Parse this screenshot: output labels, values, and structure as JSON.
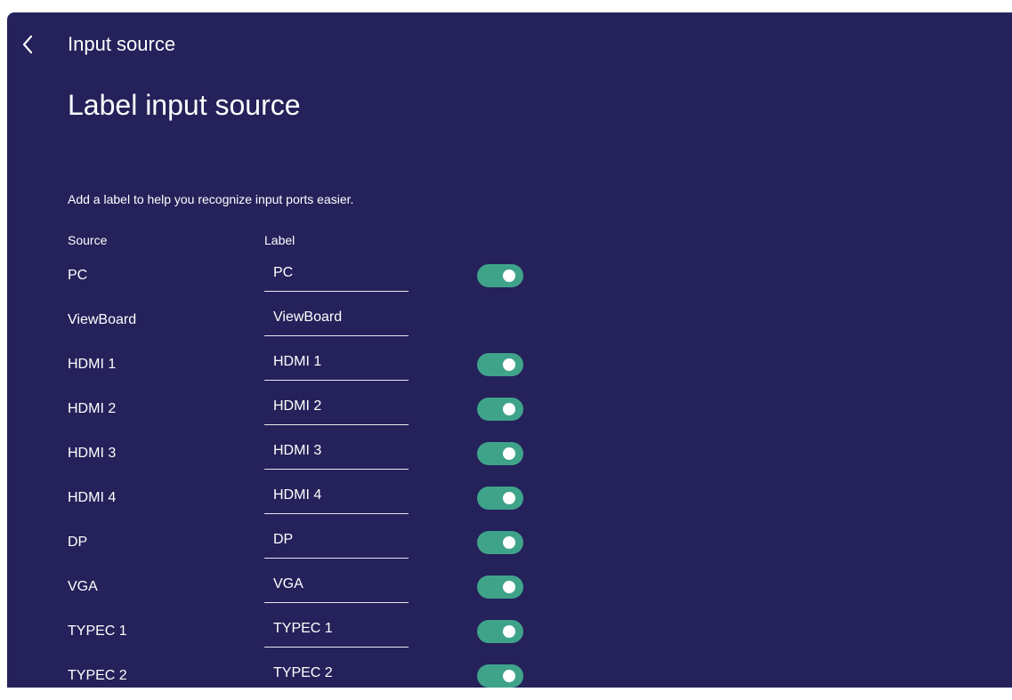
{
  "header": {
    "back_icon": "chevron-left-icon",
    "title": "Input source"
  },
  "page": {
    "title": "Label input source",
    "description": "Add a label to help you recognize input ports easier."
  },
  "columns": {
    "source": "Source",
    "label": "Label"
  },
  "colors": {
    "background": "#25215a",
    "toggle_on": "#3fa38a"
  },
  "rows": [
    {
      "source": "PC",
      "label": "PC",
      "toggle": "on"
    },
    {
      "source": "ViewBoard",
      "label": "ViewBoard",
      "toggle": null
    },
    {
      "source": "HDMI 1",
      "label": "HDMI 1",
      "toggle": "on"
    },
    {
      "source": "HDMI 2",
      "label": "HDMI 2",
      "toggle": "on"
    },
    {
      "source": "HDMI 3",
      "label": "HDMI 3",
      "toggle": "on"
    },
    {
      "source": "HDMI 4",
      "label": "HDMI 4",
      "toggle": "on"
    },
    {
      "source": "DP",
      "label": "DP",
      "toggle": "on"
    },
    {
      "source": "VGA",
      "label": "VGA",
      "toggle": "on"
    },
    {
      "source": "TYPEC 1",
      "label": "TYPEC 1",
      "toggle": "on"
    },
    {
      "source": "TYPEC 2",
      "label": "TYPEC 2",
      "toggle": "on"
    }
  ]
}
